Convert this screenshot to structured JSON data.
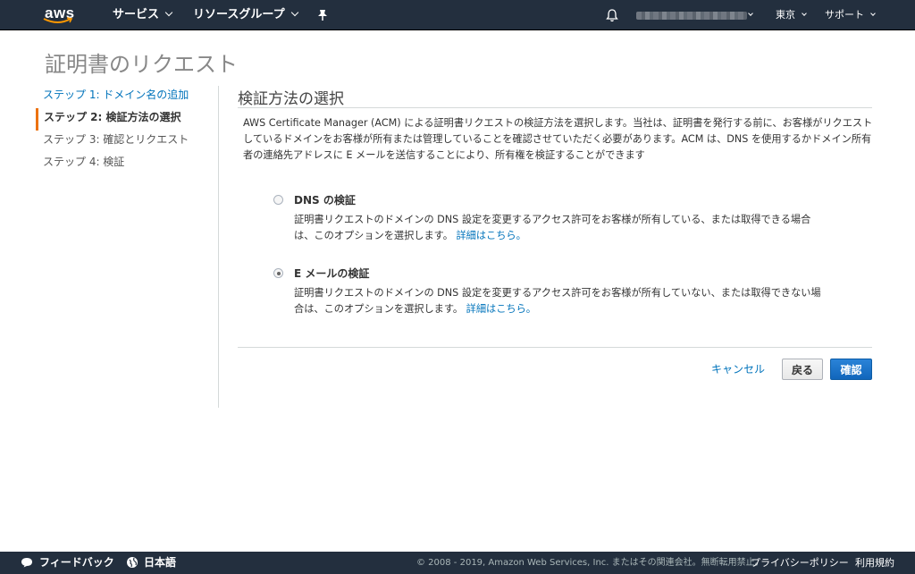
{
  "nav": {
    "logo": "aws",
    "services": "サービス",
    "resource_groups": "リソースグループ",
    "region": "東京",
    "support": "サポート",
    "pin_icon": "pin-icon",
    "bell_icon": "bell-icon"
  },
  "page": {
    "title": "証明書のリクエスト"
  },
  "steps": [
    {
      "label": "ステップ 1: ドメイン名の追加",
      "state": "link"
    },
    {
      "label": "ステップ 2: 検証方法の選択",
      "state": "active"
    },
    {
      "label": "ステップ 3: 確認とリクエスト",
      "state": "inactive"
    },
    {
      "label": "ステップ 4: 検証",
      "state": "inactive"
    }
  ],
  "main": {
    "section_title": "検証方法の選択",
    "description": "AWS Certificate Manager (ACM) による証明書リクエストの検証方法を選択します。当社は、証明書を発行する前に、お客様がリクエストしているドメインをお客様が所有または管理していることを確認させていただく必要があります。ACM は、DNS を使用するかドメイン所有者の連絡先アドレスに E メールを送信することにより、所有権を検証することができます",
    "options": [
      {
        "title": "DNS の検証",
        "description": "証明書リクエストのドメインの DNS 設定を変更するアクセス許可をお客様が所有している、または取得できる場合は、このオプションを選択します。",
        "link": "詳細はこちら。",
        "selected": false
      },
      {
        "title": "E メールの検証",
        "description": "証明書リクエストのドメインの DNS 設定を変更するアクセス許可をお客様が所有していない、または取得できない場合は、このオプションを選択します。",
        "link": "詳細はこちら。",
        "selected": true
      }
    ],
    "buttons": {
      "cancel": "キャンセル",
      "back": "戻る",
      "confirm": "確認"
    }
  },
  "footer": {
    "feedback": "フィードバック",
    "language": "日本語",
    "copyright": "© 2008 - 2019, Amazon Web Services, Inc. またはその関連会社。無断転用禁止。",
    "privacy": "プライバシーポリシー",
    "terms": "利用規約"
  },
  "colors": {
    "nav_bg": "#232f3e",
    "link": "#0073bb",
    "active_step_accent": "#ec7211",
    "primary_button": "#1166bb"
  }
}
